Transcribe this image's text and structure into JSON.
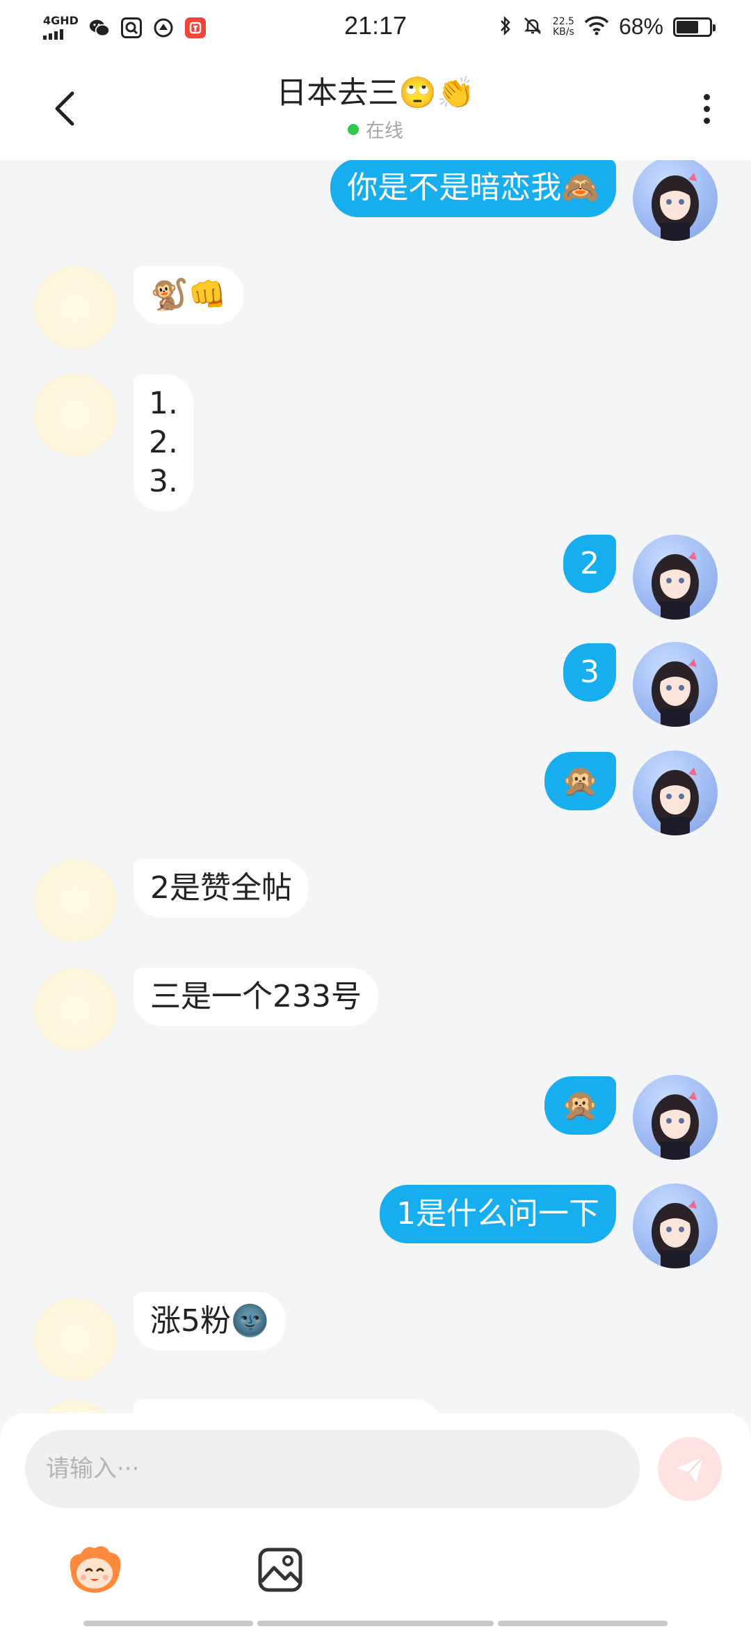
{
  "status_bar": {
    "network": "4GHD",
    "time": "21:17",
    "speed_value": "22.5",
    "speed_unit": "KB/s",
    "battery_percent": "68%",
    "battery_level": 0.68
  },
  "header": {
    "title": "日本去三🙄👏",
    "status": "在线"
  },
  "messages": [
    {
      "from": "me",
      "text": "你是不是暗恋我🙈"
    },
    {
      "from": "other",
      "text": "🐒👊"
    },
    {
      "from": "other",
      "text": "1.\n2.\n3."
    },
    {
      "from": "me",
      "text": "2"
    },
    {
      "from": "me",
      "text": "3"
    },
    {
      "from": "me",
      "text": "🙊"
    },
    {
      "from": "other",
      "text": "2是赞全帖"
    },
    {
      "from": "other",
      "text": "三是一个233号"
    },
    {
      "from": "me",
      "text": "🙊"
    },
    {
      "from": "me",
      "text": "1是什么问一下"
    },
    {
      "from": "other",
      "text": "涨5粉🌚"
    }
  ],
  "input": {
    "placeholder": "请输入···"
  },
  "colors": {
    "my_bubble": "#17aeef",
    "other_bubble": "#ffffff",
    "background": "#f4f5f7",
    "online": "#2fca4c",
    "send_button": "#ffe2e1"
  }
}
